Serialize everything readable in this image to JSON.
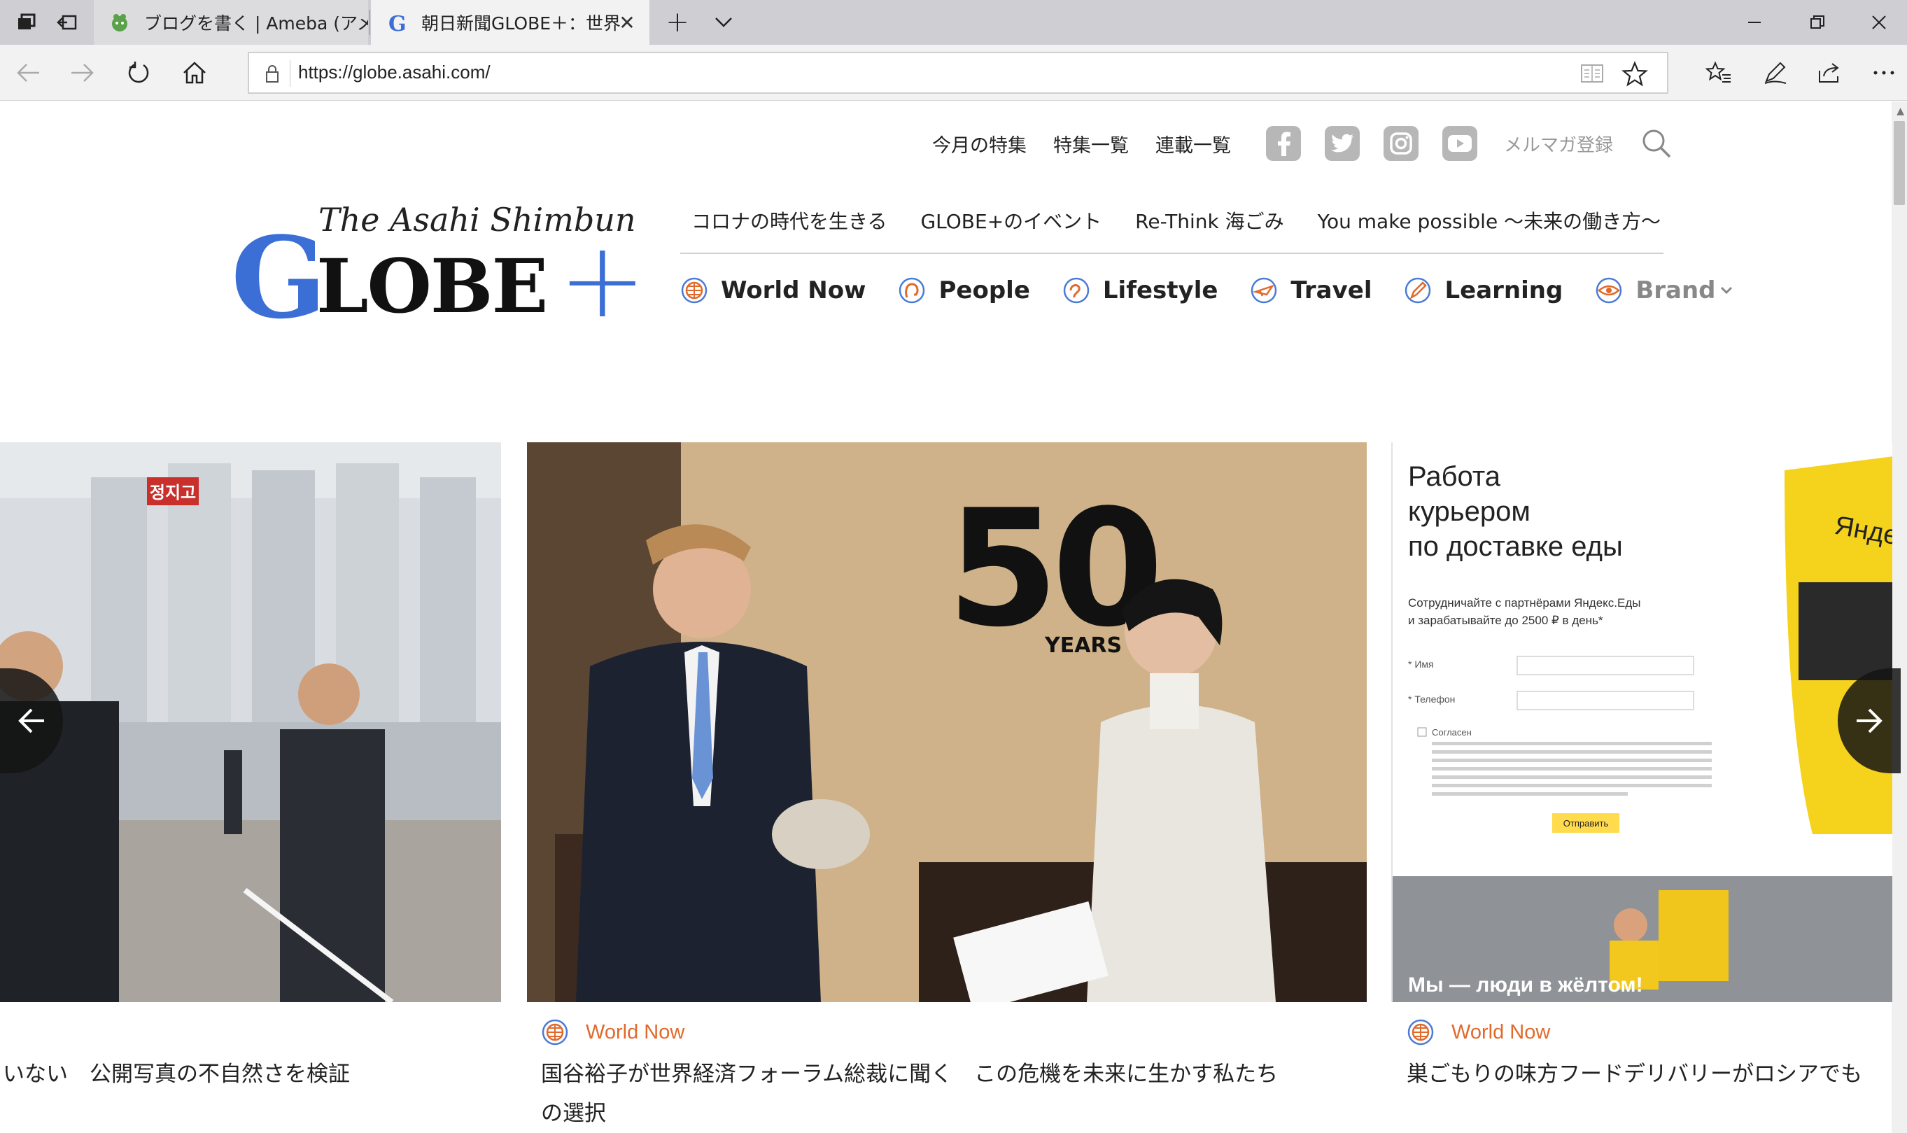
{
  "tabs": [
    {
      "label": "ブログを書く | Ameba (アメーバ",
      "active": false
    },
    {
      "label": "朝日新聞GLOBE＋：世界",
      "active": true
    }
  ],
  "browser": {
    "url": "https://globe.asahi.com/",
    "new_tab": "+"
  },
  "site": {
    "utility_links": [
      "今月の特集",
      "特集一覧",
      "連載一覧"
    ],
    "mail_signup": "メルマガ登録",
    "logo": {
      "tagline": "The Asahi Shimbun",
      "g": "G",
      "lobe": "LOBE",
      "plus": "+"
    },
    "feature_links": [
      "コロナの時代を生きる",
      "GLOBE+のイベント",
      "Re-Think 海ごみ",
      "You make possible ～未来の働き方～"
    ],
    "categories": [
      {
        "label": "World Now",
        "icon": "globe-icon"
      },
      {
        "label": "People",
        "icon": "people-icon"
      },
      {
        "label": "Lifestyle",
        "icon": "lifestyle-icon"
      },
      {
        "label": "Travel",
        "icon": "travel-icon"
      },
      {
        "label": "Learning",
        "icon": "learning-icon"
      },
      {
        "label": "Brand",
        "icon": "brand-icon"
      }
    ]
  },
  "slides": [
    {
      "title": "いない　公開写真の不自然さを検証"
    },
    {
      "category": "World Now",
      "title_line1": "国谷裕子が世界経済フォーラム総裁に聞く　この危機を未来に生かす私たち",
      "title_line2": "の選択"
    },
    {
      "category": "World Now",
      "title": "巣ごもりの味方フードデリバリーがロシアでも"
    }
  ],
  "ad": {
    "heading_1": "Работа",
    "heading_2": "курьером",
    "heading_3": "по доставке еды",
    "sub_1": "Сотрудничайте с партнёрами Яндекс.Еды",
    "sub_2": "и зарабатывайте до 2500 ₽ в день*",
    "field_name": "* Имя",
    "field_phone": "* Телефон",
    "consent": "Согласен",
    "submit": "Отправить",
    "brand": "Яндекс",
    "slogan": "Мы — люди в жёлтом!"
  },
  "photo_text": {
    "fifty": "50",
    "years": "YEARS",
    "sign": "정지고"
  },
  "colors": {
    "accent": "#3b6fd6",
    "category_orange": "#e06a2c"
  }
}
